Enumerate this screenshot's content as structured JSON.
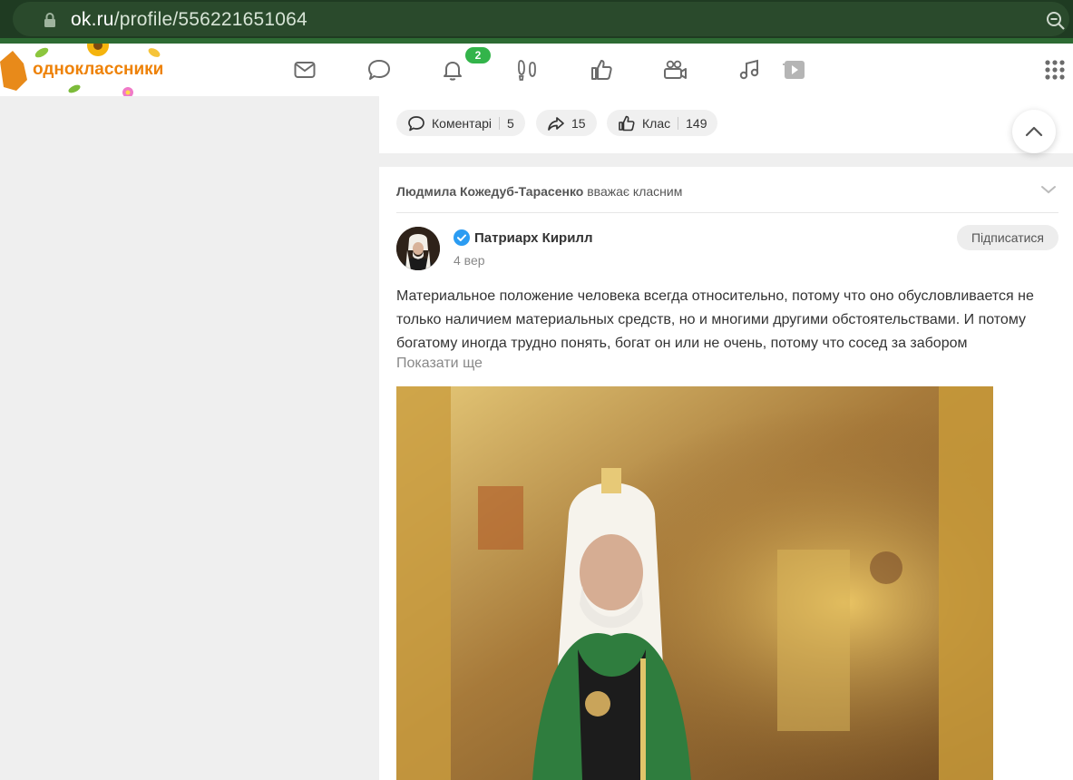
{
  "browser": {
    "url_host": "ok.ru",
    "url_path": "/profile/556221651064"
  },
  "header": {
    "logo_text": "одноклассники",
    "notifications_badge": "2",
    "nav_icons": [
      "messages-icon",
      "discussions-icon",
      "notifications-icon",
      "guests-icon",
      "events-icon",
      "friends-icon",
      "music-icon",
      "video-icon"
    ]
  },
  "prev_post": {
    "comments_label": "Коментарі",
    "comments_count": "5",
    "shares_count": "15",
    "likes_label": "Клас",
    "likes_count": "149"
  },
  "feed_item": {
    "liker_name": "Людмила Кожедуб-Тарасенко",
    "liker_action": "вважає класним",
    "author": "Патриарх Кирилл",
    "date": "4 вер",
    "subscribe_label": "Підписатися",
    "text": "Материальное положение человека всегда относительно, потому что оно обусловливается не только наличием материальных средств, но и многими другими обстоятельствами. И потому богатому иногда трудно понять, богат он или не очень, потому что сосед за забором",
    "show_more": "Показати ще"
  },
  "colors": {
    "browser_bar": "#1f3b22",
    "ok_orange": "#ee8208",
    "badge_green": "#33b44a",
    "page_bg": "#efefef"
  }
}
